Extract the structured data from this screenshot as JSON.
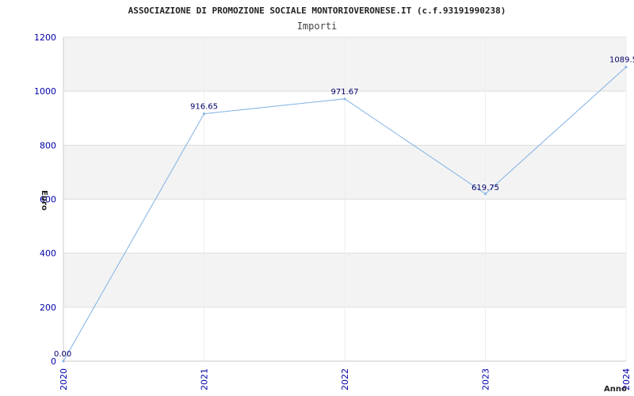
{
  "chart_data": {
    "type": "line",
    "title": "ASSOCIAZIONE DI PROMOZIONE SOCIALE MONTORIOVERONESE.IT (c.f.93191990238)",
    "subtitle": "Importi",
    "xlabel": "Anno",
    "ylabel": "Euro",
    "categories": [
      "2020",
      "2021",
      "2022",
      "2023",
      "2024"
    ],
    "series": [
      {
        "values": [
          0.0,
          916.65,
          971.67,
          619.75,
          1089.5
        ],
        "labels": [
          "0.00",
          "916.65",
          "971.67",
          "619.75",
          "1089.5"
        ]
      }
    ],
    "ylim": [
      0,
      1200
    ],
    "yticks": [
      "0",
      "200",
      "400",
      "600",
      "800",
      "1000",
      "1200"
    ],
    "grid": true,
    "colors": {
      "line": "#7fb2e5",
      "band": "#f3f3f3",
      "tick_text": "#0000aa",
      "label_text": "#000066"
    }
  }
}
